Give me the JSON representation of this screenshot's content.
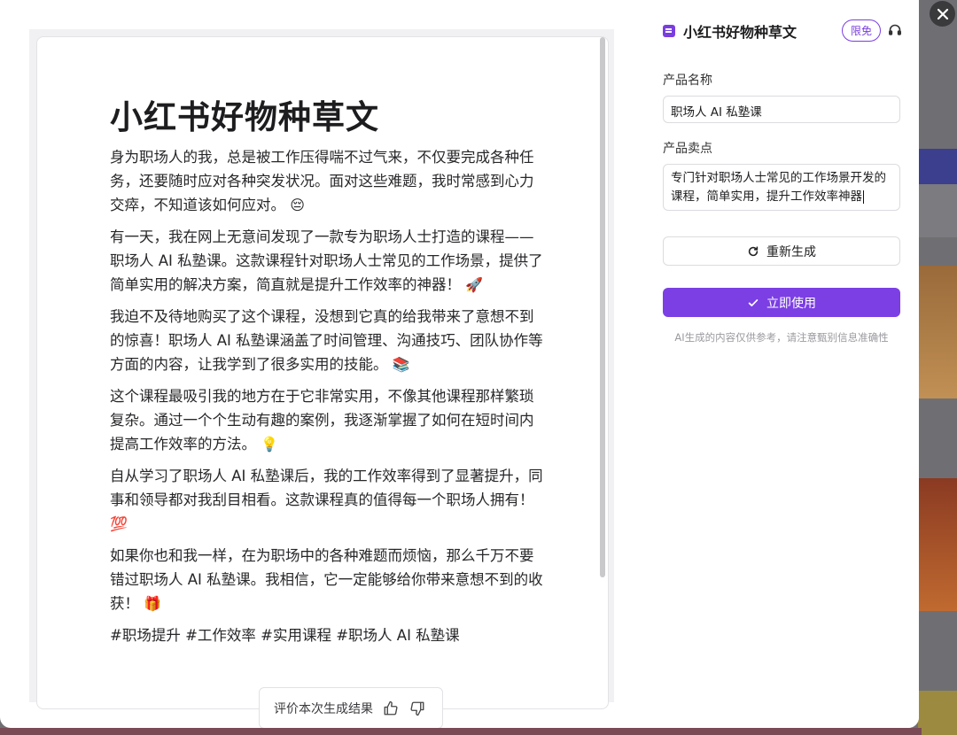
{
  "document": {
    "title": "小红书好物种草文",
    "paragraphs": [
      {
        "text": "身为职场人的我，总是被工作压得喘不过气来，不仅要完成各种任务，还要随时应对各种突发状况。面对这些难题，我时常感到心力交瘁，不知道该如何应对。",
        "emoji": "😔"
      },
      {
        "text": "有一天，我在网上无意间发现了一款专为职场人士打造的课程——职场人 AI 私塾课。这款课程针对职场人士常见的工作场景，提供了简单实用的解决方案，简直就是提升工作效率的神器！",
        "emoji": "🚀"
      },
      {
        "text": "我迫不及待地购买了这个课程，没想到它真的给我带来了意想不到的惊喜！职场人 AI 私塾课涵盖了时间管理、沟通技巧、团队协作等方面的内容，让我学到了很多实用的技能。",
        "emoji": "📚"
      },
      {
        "text": "这个课程最吸引我的地方在于它非常实用，不像其他课程那样繁琐复杂。通过一个个生动有趣的案例，我逐渐掌握了如何在短时间内提高工作效率的方法。",
        "emoji": "💡"
      },
      {
        "text": "自从学习了职场人 AI 私塾课后，我的工作效率得到了显著提升，同事和领导都对我刮目相看。这款课程真的值得每一个职场人拥有！",
        "emoji": "💯"
      },
      {
        "text": "如果你也和我一样，在为职场中的各种难题而烦恼，那么千万不要错过职场人 AI 私塾课。我相信，它一定能够给你带来意想不到的收获！",
        "emoji": "🎁"
      }
    ],
    "hashtags": "#职场提升 #工作效率 #实用课程 #职场人 AI 私塾课"
  },
  "rating": {
    "label": "评价本次生成结果",
    "thumb_up_icon": "thumb-up-icon",
    "thumb_down_icon": "thumb-down-icon"
  },
  "panel": {
    "title": "小红书好物种草文",
    "badge": "限免",
    "product_name_label": "产品名称",
    "product_name_value": "职场人 AI 私塾课",
    "selling_point_label": "产品卖点",
    "selling_point_value": "专门针对职场人士常见的工作场景开发的课程，简单实用，提升工作效率神器",
    "regenerate_label": "重新生成",
    "use_label": "立即使用",
    "disclaimer": "AI生成的内容仅供参考，请注意甄别信息准确性"
  },
  "colors": {
    "accent": "#7b3fe4",
    "close_button": "#3a3a3c"
  }
}
